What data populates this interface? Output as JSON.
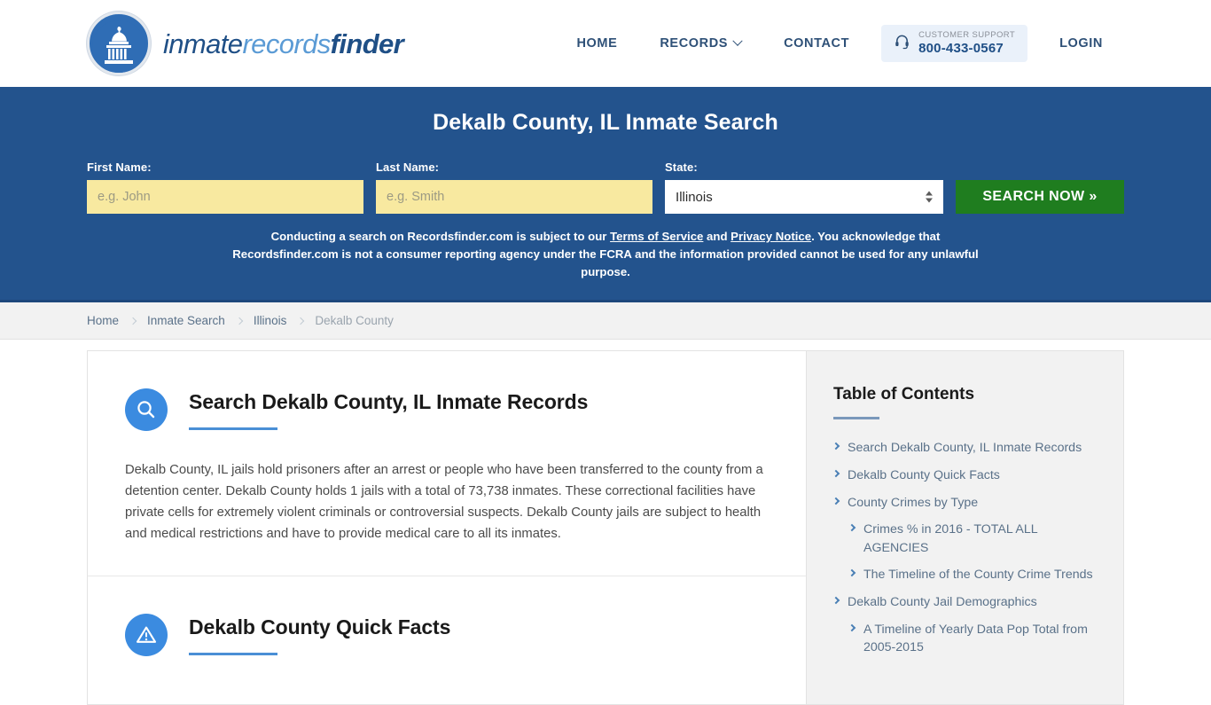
{
  "header": {
    "logo": {
      "icon": "capitol-dome-icon",
      "part1": "inmate",
      "part2": "records",
      "part3": "finder"
    },
    "nav": [
      {
        "label": "HOME",
        "name": "nav-home"
      },
      {
        "label": "RECORDS",
        "name": "nav-records",
        "caret": true
      },
      {
        "label": "CONTACT",
        "name": "nav-contact"
      }
    ],
    "support": {
      "icon": "headset-icon",
      "label": "CUSTOMER SUPPORT",
      "phone": "800-433-0567"
    },
    "login_label": "LOGIN"
  },
  "hero": {
    "title": "Dekalb County, IL Inmate Search",
    "first_name_label": "First Name:",
    "first_name_placeholder": "e.g. John",
    "first_name_value": "",
    "last_name_label": "Last Name:",
    "last_name_placeholder": "e.g. Smith",
    "last_name_value": "",
    "state_label": "State:",
    "state_value": "Illinois",
    "search_button": "SEARCH NOW »",
    "disclaimer_part1": "Conducting a search on Recordsfinder.com is subject to our ",
    "disclaimer_link1": "Terms of Service",
    "disclaimer_and": " and ",
    "disclaimer_link2": "Privacy Notice",
    "disclaimer_part2": ". You acknowledge that Recordsfinder.com is not a consumer reporting agency under the FCRA and the information provided cannot be used for any unlawful purpose."
  },
  "breadcrumb": [
    {
      "label": "Home",
      "current": false
    },
    {
      "label": "Inmate Search",
      "current": false
    },
    {
      "label": "Illinois",
      "current": false
    },
    {
      "label": "Dekalb County",
      "current": true
    }
  ],
  "main": {
    "sections": [
      {
        "icon": "magnifier-icon",
        "title": "Search Dekalb County, IL Inmate Records",
        "body": "Dekalb County, IL jails hold prisoners after an arrest or people who have been transferred to the county from a detention center. Dekalb County holds 1 jails with a total of 73,738 inmates. These correctional facilities have private cells for extremely violent criminals or controversial suspects. Dekalb County jails are subject to health and medical restrictions and have to provide medical care to all its inmates."
      },
      {
        "icon": "warning-triangle-icon",
        "title": "Dekalb County Quick Facts",
        "body": ""
      }
    ]
  },
  "sidebar": {
    "title": "Table of Contents",
    "items": [
      {
        "label": "Search Dekalb County, IL Inmate Records",
        "sub": false
      },
      {
        "label": "Dekalb County Quick Facts",
        "sub": false
      },
      {
        "label": "County Crimes by Type",
        "sub": false
      },
      {
        "label": "Crimes % in 2016 - TOTAL ALL AGENCIES",
        "sub": true
      },
      {
        "label": "The Timeline of the County Crime Trends",
        "sub": true
      },
      {
        "label": "Dekalb County Jail Demographics",
        "sub": false
      },
      {
        "label": "A Timeline of Yearly Data Pop Total from 2005-2015",
        "sub": true
      }
    ]
  },
  "colors": {
    "hero_blue": "#23538d",
    "accent_blue": "#3b8be0",
    "green_button": "#1f7d1f",
    "input_yellow": "#f8e9a0",
    "sidebar_gray": "#f2f2f2"
  }
}
